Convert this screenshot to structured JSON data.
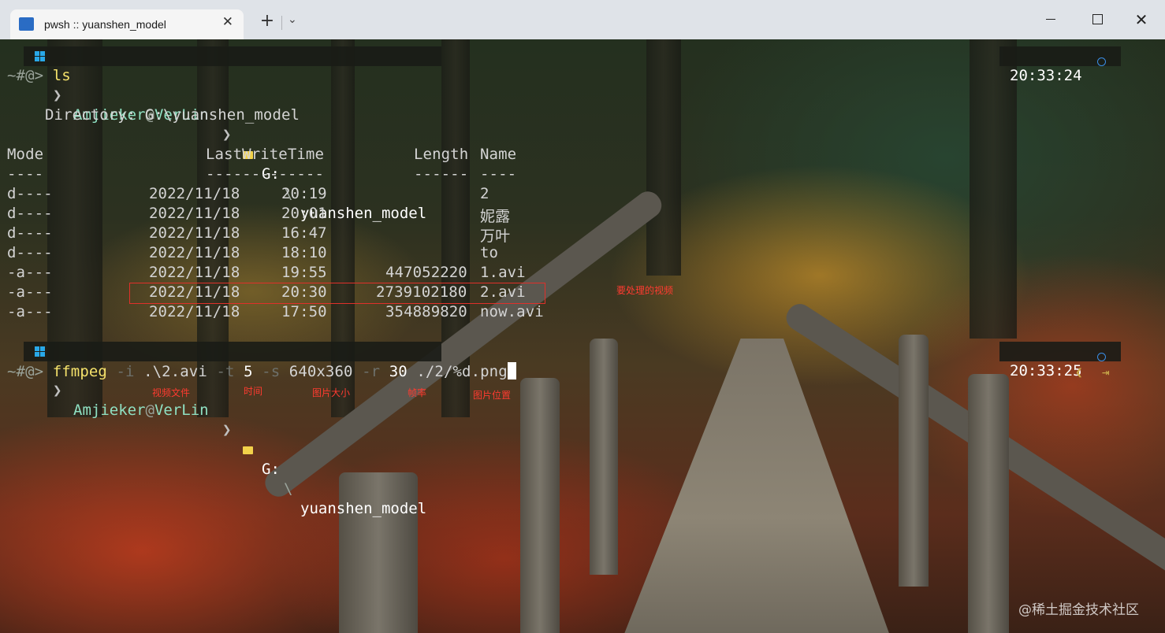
{
  "window": {
    "tab_title": "pwsh :: yuanshen_model",
    "tab_close": "✕",
    "new_tab": "+",
    "dropdown": "⌄",
    "close": "✕"
  },
  "prompt1": {
    "user": "Amjieker",
    "at": "@",
    "host": "VerLin",
    "drive": "G:",
    "path_sep": "\\",
    "path": "yuanshen_model",
    "time": "20:33:24",
    "ps": "~#@>",
    "command": "ls"
  },
  "ls": {
    "directory_line": "Directory: G:\\yuanshen_model",
    "headers": {
      "mode": "Mode",
      "lwt": "LastWriteTime",
      "length": "Length",
      "name": "Name"
    },
    "underlines": {
      "mode": "----",
      "lwt": "-------------",
      "length": "------",
      "name": "----"
    },
    "rows": [
      {
        "mode": "d----",
        "date": "2022/11/18",
        "time": "20:19",
        "length": "",
        "name": "2"
      },
      {
        "mode": "d----",
        "date": "2022/11/18",
        "time": "20:01",
        "length": "",
        "name": "妮露"
      },
      {
        "mode": "d----",
        "date": "2022/11/18",
        "time": "16:47",
        "length": "",
        "name": "万叶"
      },
      {
        "mode": "d----",
        "date": "2022/11/18",
        "time": "18:10",
        "length": "",
        "name": "to"
      },
      {
        "mode": "-a---",
        "date": "2022/11/18",
        "time": "19:55",
        "length": "447052220",
        "name": "1.avi"
      },
      {
        "mode": "-a---",
        "date": "2022/11/18",
        "time": "20:30",
        "length": "2739102180",
        "name": "2.avi"
      },
      {
        "mode": "-a---",
        "date": "2022/11/18",
        "time": "17:50",
        "length": "354889820",
        "name": "now.avi"
      }
    ]
  },
  "prompt2": {
    "user": "Amjieker",
    "at": "@",
    "host": "VerLin",
    "drive": "G:",
    "path_sep": "\\",
    "path": "yuanshen_model",
    "time": "20:33:25",
    "ps": "~#@>",
    "cmd": "ffmpeg",
    "flag_i": "-i",
    "arg_i": ".\\2.avi",
    "flag_t": "-t",
    "arg_t": "5",
    "flag_s": "-s",
    "arg_s": "640x360",
    "flag_r": "-r",
    "arg_r": "30",
    "arg_out": "./2/%d.png"
  },
  "annotations": {
    "video_to_process": "要处理的视频",
    "video_file": "视频文件",
    "time": "时间",
    "image_size": "图片大小",
    "frame_rate": "帧率",
    "image_location": "图片位置"
  },
  "watermark": "@稀土掘金技术社区",
  "icons": [
    "terminal-icon",
    "windows-icon",
    "folder-icon",
    "clock-icon",
    "chevron-left-icon",
    "exit-icon"
  ],
  "colors": {
    "user": "#8fe0c2",
    "highlight_box": "#e0302a",
    "annotation": "#ff3b30",
    "cursor": "#ffffff"
  }
}
